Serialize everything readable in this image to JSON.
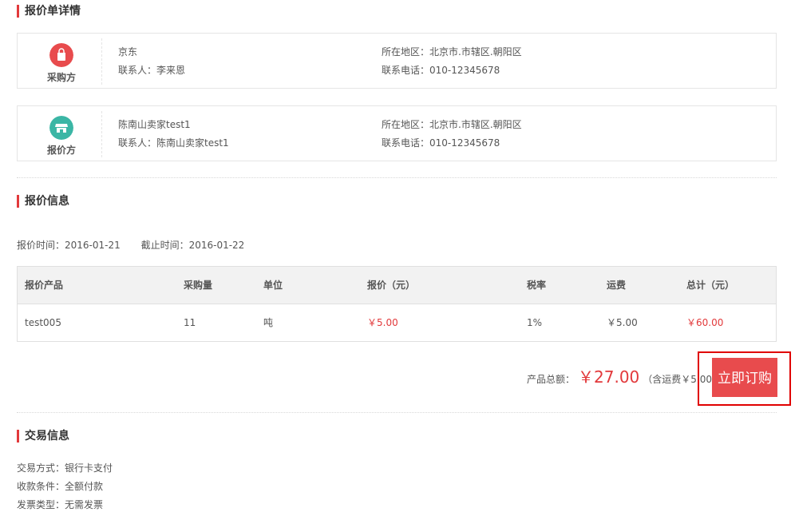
{
  "quote_detail": {
    "section_title": "报价单详情"
  },
  "buyer": {
    "role_label": "采购方",
    "company": "京东",
    "contact": "联系人：李来恩",
    "region": "所在地区：北京市.市辖区.朝阳区",
    "phone": "联系电话：010-12345678",
    "icon": "shopping-bag-icon",
    "icon_color": "#e84b4d"
  },
  "seller": {
    "role_label": "报价方",
    "company": "陈南山卖家test1",
    "contact": "联系人：陈南山卖家test1",
    "region": "所在地区：北京市.市辖区.朝阳区",
    "phone": "联系电话：010-12345678",
    "icon": "storefront-icon",
    "icon_color": "#3bb6a5"
  },
  "quote_info": {
    "section_title": "报价信息",
    "quote_time": "报价时间：2016-01-21",
    "deadline": "截止时间：2016-01-22"
  },
  "table": {
    "headers": [
      "报价产品",
      "采购量",
      "单位",
      "报价（元）",
      "税率",
      "运费",
      "总计（元）"
    ],
    "rows": [
      {
        "product": "test005",
        "quantity": "11",
        "unit": "吨",
        "price": "￥5.00",
        "tax": "1%",
        "shipping": "￥5.00",
        "total": "￥60.00"
      }
    ]
  },
  "summary": {
    "label": "产品总额：",
    "amount": "￥27.00",
    "shipping_note": "（含运费￥5.00）",
    "order_button": "立即订购"
  },
  "trade_info": {
    "section_title": "交易信息",
    "payment": "交易方式：银行卡支付",
    "terms": "收款条件：全额付款",
    "invoice": "发票类型：无需发票"
  },
  "colors": {
    "accent": "#e2393b",
    "button": "#e84b4d",
    "highlight_border": "#e00000"
  }
}
